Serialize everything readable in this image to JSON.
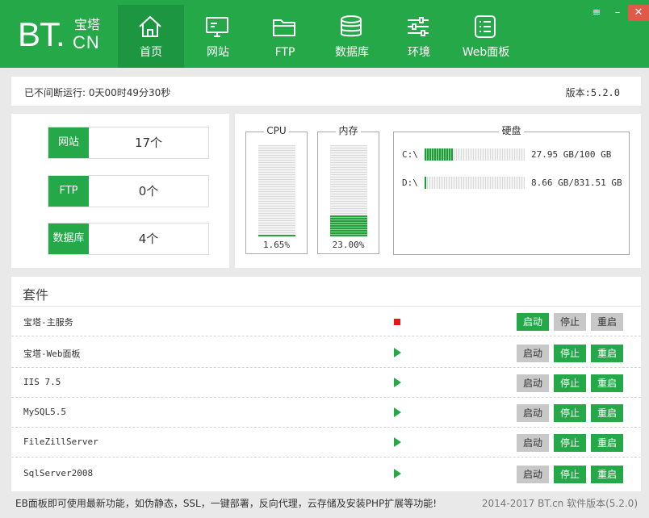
{
  "brand": {
    "main": "BT.",
    "top": "宝塔",
    "bottom": "CN"
  },
  "nav": [
    {
      "label": "首页",
      "icon": "home-icon",
      "active": true
    },
    {
      "label": "网站",
      "icon": "monitor-icon"
    },
    {
      "label": "FTP",
      "icon": "folder-icon"
    },
    {
      "label": "数据库",
      "icon": "database-icon"
    },
    {
      "label": "环境",
      "icon": "sliders-icon"
    },
    {
      "label": "Web面板",
      "icon": "list-icon"
    }
  ],
  "window_controls": {
    "menu": "≡",
    "minimize": "–",
    "close": "✕"
  },
  "status": {
    "uptime": "已不间断运行: 0天00时49分30秒",
    "version": "版本:5.2.0"
  },
  "stats": [
    {
      "label": "网站",
      "value": "17个"
    },
    {
      "label": "FTP",
      "value": "0个"
    },
    {
      "label": "数据库",
      "value": "4个"
    }
  ],
  "cpu": {
    "title": "CPU",
    "percent": 1.65,
    "text": "1.65%"
  },
  "memory": {
    "title": "内存",
    "percent": 23.0,
    "text": "23.00%"
  },
  "disk": {
    "title": "硬盘",
    "drives": [
      {
        "label": "C:\\",
        "used_gb": 27.95,
        "total_gb": 100,
        "text": "27.95 GB/100 GB"
      },
      {
        "label": "D:\\",
        "used_gb": 8.66,
        "total_gb": 831.51,
        "text": "8.66 GB/831.51 GB"
      }
    ]
  },
  "suite": {
    "title": "套件",
    "buttons": {
      "start": "启动",
      "stop": "停止",
      "restart": "重启"
    },
    "services": [
      {
        "name": "宝塔-主服务",
        "running": false
      },
      {
        "name": "宝塔-Web面板",
        "running": true
      },
      {
        "name": "IIS 7.5",
        "running": true
      },
      {
        "name": "MySQL5.5",
        "running": true
      },
      {
        "name": "FileZillServer",
        "running": true
      },
      {
        "name": "SqlServer2008",
        "running": true
      }
    ]
  },
  "footer": {
    "notice": "EB面板即可使用最新功能，如伪静态，SSL，一键部署，反向代理，云存储及安装PHP扩展等功能!",
    "copyright": "2014-2017 BT.cn  软件版本(5.2.0)"
  },
  "colors": {
    "brand_green": "#24a848",
    "stop_red": "#e81313",
    "disabled_gray": "#c8c8c8"
  }
}
